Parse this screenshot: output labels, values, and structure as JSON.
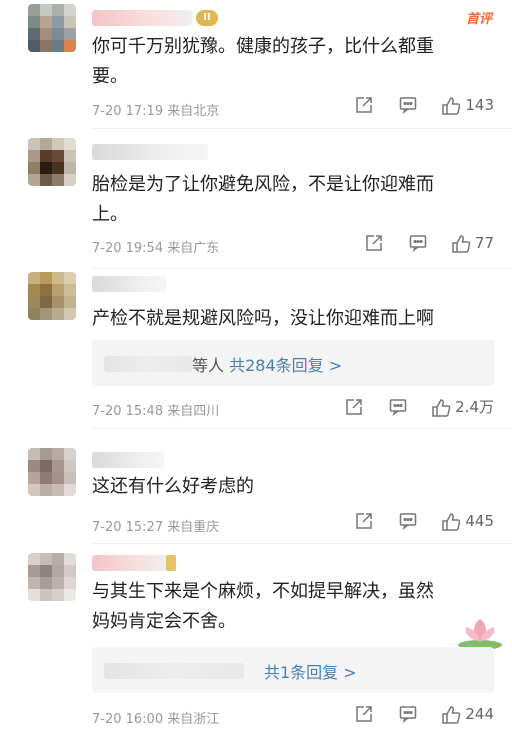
{
  "comments": [
    {
      "text": "你可千万别犹豫。健康的孩子，比什么都重要。",
      "text_lines": [
        "你可千万别犹豫。健康的孩子，比什么都重",
        "要。"
      ],
      "level_badge": "II",
      "top_badge": "首评",
      "time": "7-20 17:19",
      "location": "来自北京",
      "likes": "143"
    },
    {
      "text": "胎检是为了让你避免风险，不是让你迎难而上。",
      "text_lines": [
        "胎检是为了让你避免风险，不是让你迎难而",
        "上。"
      ],
      "time": "7-20 19:54",
      "location": "来自广东",
      "likes": "77"
    },
    {
      "text": "产检不就是规避风险吗，没让你迎难而上啊",
      "text_lines": [
        "产检不就是规避风险吗，没让你迎难而上啊"
      ],
      "reply_prefix": "等人",
      "reply_label": "共284条回复 >",
      "time": "7-20 15:48",
      "location": "来自四川",
      "likes": "2.4万"
    },
    {
      "text": "这还有什么好考虑的",
      "text_lines": [
        "这还有什么好考虑的"
      ],
      "time": "7-20 15:27",
      "location": "来自重庆",
      "likes": "445"
    },
    {
      "text": "与其生下来是个麻烦，不如提早解决，虽然妈妈肯定会不舍。",
      "text_lines": [
        "与其生下来是个麻烦，不如提早解决，虽然",
        "妈妈肯定会不舍。"
      ],
      "reply_label": "共1条回复 >",
      "time": "7-20 16:00",
      "location": "来自浙江",
      "likes": "244"
    }
  ],
  "icons": {
    "share": "share-icon",
    "comment": "comment-icon",
    "like": "like-icon"
  },
  "colors": {
    "link": "#4a7fb6",
    "meta": "#999999",
    "top_badge": "#f26a3a"
  }
}
